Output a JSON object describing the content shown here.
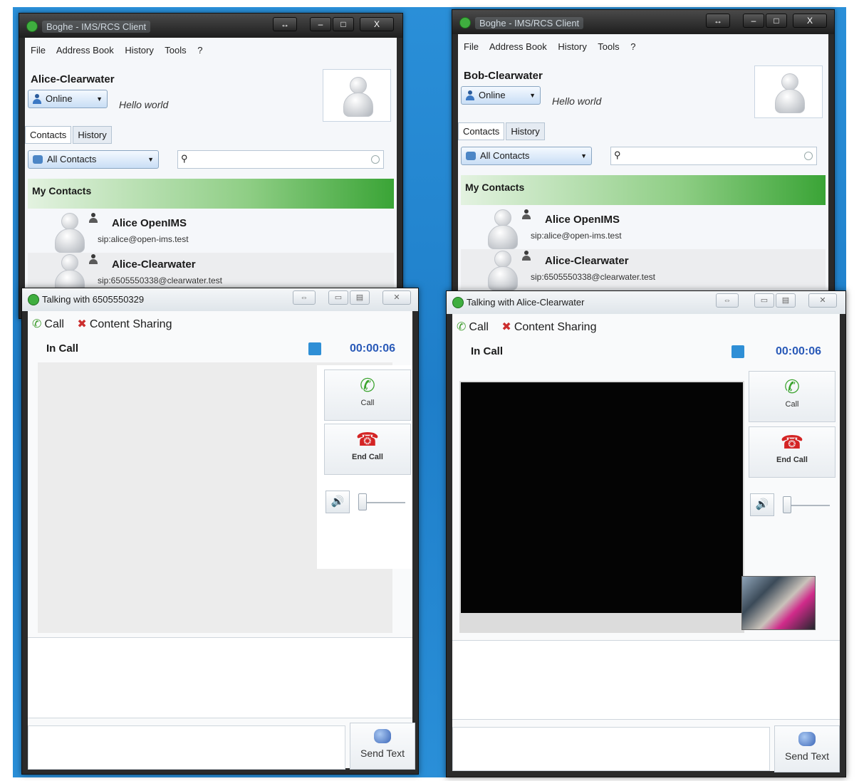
{
  "left": {
    "main": {
      "title": "Boghe - IMS/RCS Client",
      "menu": [
        "File",
        "Address Book",
        "History",
        "Tools",
        "?"
      ],
      "user_name": "Alice-Clearwater",
      "status": "Online",
      "status_message": "Hello world",
      "tabs": [
        "Contacts",
        "History"
      ],
      "filter": "All Contacts",
      "search_placeholder": "",
      "group": "My Contacts",
      "contacts": [
        {
          "name": "Alice OpenIMS",
          "sip": "sip:alice@open-ims.test"
        },
        {
          "name": "Alice-Clearwater",
          "sip": "sip:6505550338@clearwater.test"
        }
      ]
    },
    "call": {
      "title": "Talking with 6505550329",
      "toolbar_call": "Call",
      "toolbar_share": "Content Sharing",
      "state": "In Call",
      "timer": "00:00:06",
      "call_btn": "Call",
      "end_btn": "End Call",
      "send_btn": "Send Text"
    }
  },
  "right": {
    "main": {
      "title": "Boghe - IMS/RCS Client",
      "menu": [
        "File",
        "Address Book",
        "History",
        "Tools",
        "?"
      ],
      "user_name": "Bob-Clearwater",
      "status": "Online",
      "status_message": "Hello world",
      "tabs": [
        "Contacts",
        "History"
      ],
      "filter": "All Contacts",
      "search_placeholder": "",
      "group": "My Contacts",
      "contacts": [
        {
          "name": "Alice OpenIMS",
          "sip": "sip:alice@open-ims.test"
        },
        {
          "name": "Alice-Clearwater",
          "sip": "sip:6505550338@clearwater.test"
        }
      ]
    },
    "call": {
      "title": "Talking with Alice-Clearwater",
      "toolbar_call": "Call",
      "toolbar_share": "Content Sharing",
      "state": "In Call",
      "timer": "00:00:06",
      "call_btn": "Call",
      "end_btn": "End Call",
      "send_btn": "Send Text"
    }
  },
  "colors": {
    "desktop": "#1e7ec9",
    "group_header": "#3aa436",
    "timer": "#2a5ab8",
    "call_icon": "#3aa32d",
    "end_icon": "#d42424"
  },
  "icons": {
    "window": "boghe-app-icon",
    "contact": "person-icon",
    "search": "search-icon",
    "call": "phone-icon",
    "end": "hangup-icon",
    "volume": "speaker-icon",
    "send": "chat-bubbles-icon"
  }
}
